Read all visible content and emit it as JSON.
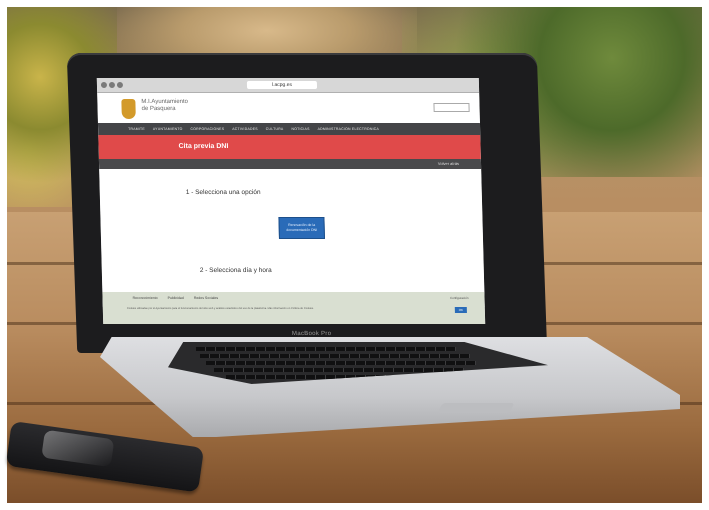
{
  "browser": {
    "url_text": "l.acpg.es"
  },
  "site": {
    "title_line1": "M.I.Ayuntamiento",
    "title_line2": "de Pasquera",
    "nav_items": [
      "TRAMITE",
      "AYUNTAMIENTO",
      "CORPORACIONES",
      "ACTIVIDADES",
      "CULTURA",
      "NOTICIAS",
      "ADMINISTRACION ELECTRONICA"
    ]
  },
  "page": {
    "banner_title": "Cita previa DNI",
    "sub_link": "Volver atrás",
    "step1": "1 - Selecciona una opción",
    "option_button": "Renovación de la documentación DNI",
    "step2": "2 - Selecciona día y hora"
  },
  "cookies": {
    "tabs": [
      "Reconocimiento",
      "Publicidad",
      "Redes Sociales"
    ],
    "config": "Configuración",
    "text": "Cookies utilizadas por el Ayuntamiento para el funcionamiento del sitio web y análisis estadístico del uso de la plataforma. Más información en Política de Cookies.",
    "accept": "OK"
  },
  "laptop": {
    "brand": "MacBook Pro"
  },
  "colors": {
    "banner": "#e04a4a",
    "nav": "#444548",
    "button": "#2a6bb8"
  }
}
